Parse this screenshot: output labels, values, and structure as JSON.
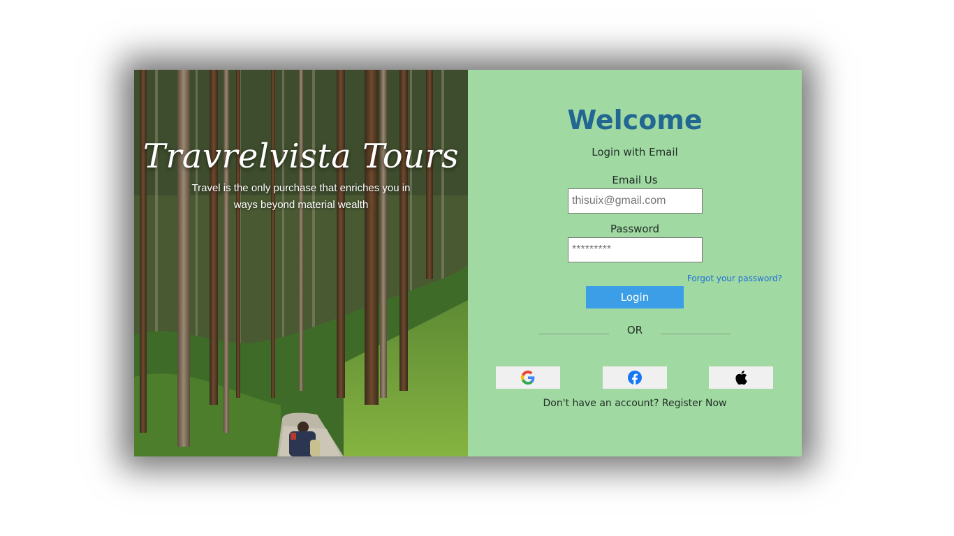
{
  "hero": {
    "brand": "Travrelvista Tours",
    "tagline": "Travel is the only purchase that enriches you in ways beyond material wealth"
  },
  "form": {
    "title": "Welcome",
    "subtitle": "Login with Email",
    "email_label": "Email Us",
    "email_placeholder": "thisuix@gmail.com",
    "password_label": "Password",
    "password_placeholder": "*********",
    "forgot_link": "Forgot your password?",
    "login_button": "Login",
    "divider_text": "OR",
    "register_prompt": "Don't have an account?",
    "register_link": "Register Now"
  },
  "social": [
    {
      "provider": "Google",
      "icon": "google-icon"
    },
    {
      "provider": "Facebook",
      "icon": "facebook-icon"
    },
    {
      "provider": "Apple",
      "icon": "apple-icon"
    }
  ],
  "colors": {
    "panel_bg": "#a1d9a2",
    "title": "#226692",
    "button": "#3b9ee6",
    "link": "#2170d8"
  }
}
